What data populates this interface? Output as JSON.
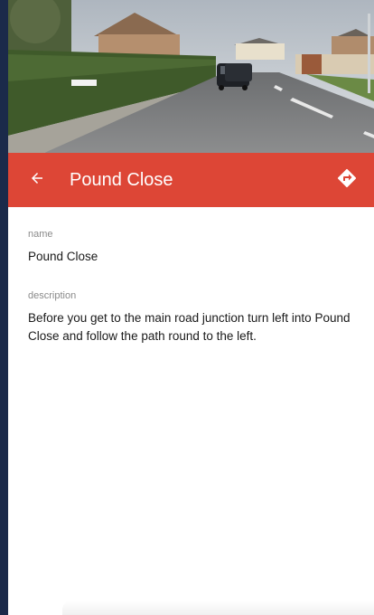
{
  "header": {
    "title": "Pound Close",
    "back_icon": "arrow-left-icon",
    "directions_icon": "directions-icon",
    "accent": "#dd4636"
  },
  "hero": {
    "description_icon": "street-photo"
  },
  "details": {
    "name_label": "name",
    "name_value": "Pound Close",
    "description_label": "description",
    "description_value": "Before you get to the main road junction turn left into Pound Close and follow the path round to the left."
  }
}
